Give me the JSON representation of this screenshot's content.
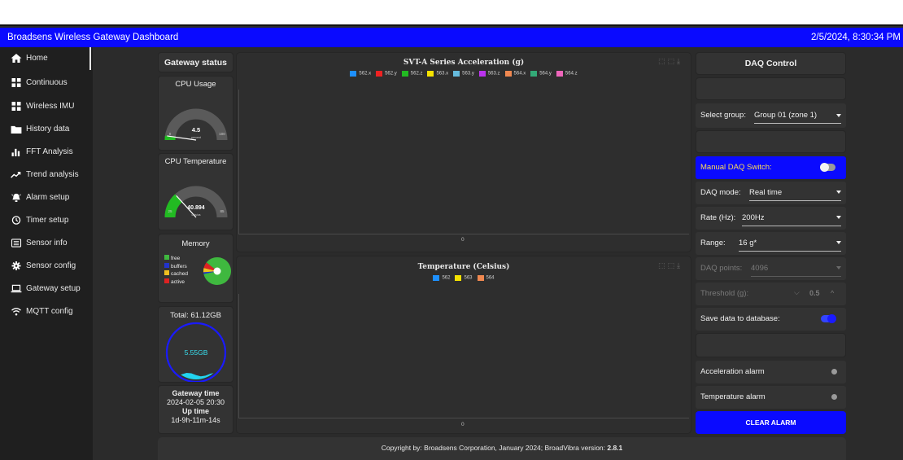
{
  "app": {
    "title": "Broadsens Wireless Gateway Dashboard",
    "datetime": "2/5/2024, 8:30:34 PM"
  },
  "sidebar": {
    "items": [
      {
        "label": "Home",
        "icon": "home-icon"
      },
      {
        "label": "Continuous",
        "icon": "grid-icon"
      },
      {
        "label": "Wireless IMU",
        "icon": "grid-icon"
      },
      {
        "label": "History data",
        "icon": "folder-icon"
      },
      {
        "label": "FFT Analysis",
        "icon": "bar-chart-icon"
      },
      {
        "label": "Trend analysis",
        "icon": "trend-icon"
      },
      {
        "label": "Alarm setup",
        "icon": "alarm-icon"
      },
      {
        "label": "Timer setup",
        "icon": "clock-icon"
      },
      {
        "label": "Sensor info",
        "icon": "list-icon"
      },
      {
        "label": "Sensor config",
        "icon": "gear-icon"
      },
      {
        "label": "Gateway setup",
        "icon": "laptop-icon"
      },
      {
        "label": "MQTT config",
        "icon": "wifi-icon"
      }
    ]
  },
  "status": {
    "heading": "Gateway status",
    "cpu_usage": {
      "title": "CPU Usage",
      "value": "4.5",
      "unit": "percent",
      "min": "0",
      "max": "100",
      "fraction": 0.045
    },
    "cpu_temp": {
      "title": "CPU Temperature",
      "value": "40.894",
      "unit": "celsius",
      "min": "25",
      "max": "85",
      "fraction": 0.265
    },
    "memory": {
      "title": "Memory",
      "legend": [
        {
          "label": "free",
          "color": "#3fb83f"
        },
        {
          "label": "buffers",
          "color": "#2233cc"
        },
        {
          "label": "cached",
          "color": "#f0c020"
        },
        {
          "label": "active",
          "color": "#dd2222"
        }
      ],
      "fractions": [
        0.86,
        0.02,
        0.05,
        0.07
      ]
    },
    "disk": {
      "total": "Total: 61.12GB",
      "used": "5.55GB",
      "fill_fraction": 0.09
    },
    "gateway_time_label": "Gateway time",
    "gateway_time": "2024-02-05 20:30",
    "uptime_label": "Up time",
    "uptime": "1d-9h-11m-14s"
  },
  "charts": {
    "accel": {
      "title": "SVT-A Series Acceleration (g)",
      "series": [
        {
          "name": "562.x",
          "color": "#1e90ff"
        },
        {
          "name": "562.y",
          "color": "#ee2222"
        },
        {
          "name": "562.z",
          "color": "#22bb22"
        },
        {
          "name": "563.x",
          "color": "#f5e200"
        },
        {
          "name": "563.y",
          "color": "#66bbdd"
        },
        {
          "name": "563.z",
          "color": "#bb33ee"
        },
        {
          "name": "564.x",
          "color": "#f08850"
        },
        {
          "name": "564.y",
          "color": "#33aa77"
        },
        {
          "name": "564.z",
          "color": "#ee66bb"
        }
      ],
      "x_tick": "0"
    },
    "temp": {
      "title": "Temperature (Celsius)",
      "series": [
        {
          "name": "562",
          "color": "#1e90ff"
        },
        {
          "name": "563",
          "color": "#f5e200"
        },
        {
          "name": "564",
          "color": "#f08850"
        }
      ],
      "x_tick": "0"
    }
  },
  "daq": {
    "title": "DAQ Control",
    "select_group": {
      "label": "Select group:",
      "value": "Group 01 (zone 1)"
    },
    "manual_switch": {
      "label": "Manual DAQ Switch:",
      "on": false
    },
    "mode": {
      "label": "DAQ mode:",
      "value": "Real time"
    },
    "rate": {
      "label": "Rate (Hz):",
      "value": "200Hz"
    },
    "range": {
      "label": "Range:",
      "value": "16 g*"
    },
    "points": {
      "label": "DAQ points:",
      "value": "4096"
    },
    "threshold": {
      "label": "Threshold (g):",
      "value": "0.5"
    },
    "save_db": {
      "label": "Save data to database:",
      "on": true
    },
    "accel_alarm": "Acceleration alarm",
    "temp_alarm": "Temperature alarm",
    "clear_alarm": "CLEAR ALARM"
  },
  "footer": {
    "text": "Copyright by: Broadsens Corporation, January 2024; BroadVibra version: ",
    "version": "2.8.1"
  }
}
